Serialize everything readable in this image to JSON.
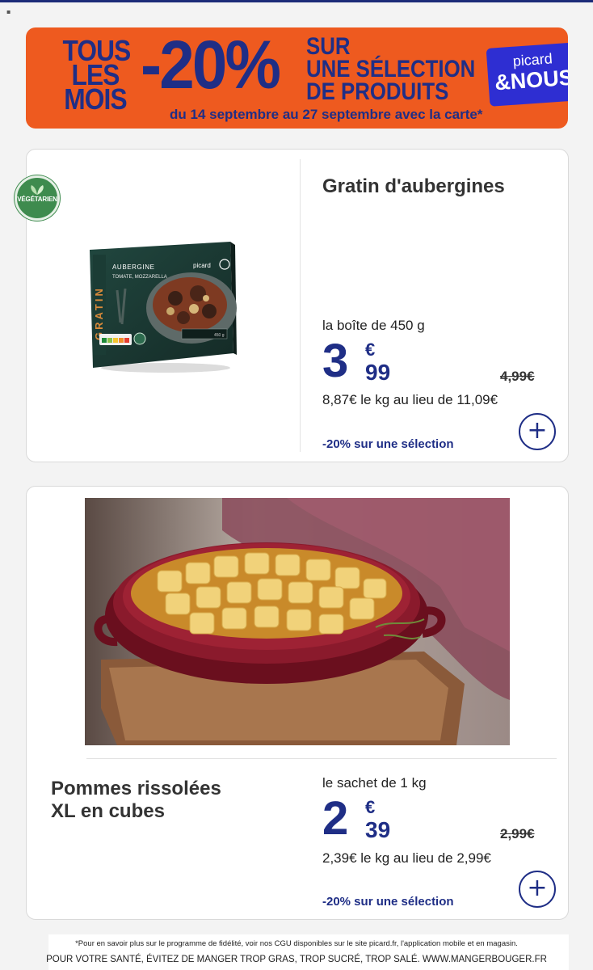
{
  "banner": {
    "line_left": [
      "TOUS",
      "LES",
      "MOIS"
    ],
    "discount": "-20%",
    "line_right": [
      "SUR",
      "UNE SÉLECTION",
      "DE PRODUITS"
    ],
    "dates": "du 14 septembre au 27 septembre avec la carte*",
    "logo_top": "picard",
    "logo_bottom": "&NOUS",
    "bg_color": "#ee5a1f",
    "text_color": "#1f2e86"
  },
  "products": [
    {
      "badge": "VÉGÉTARIEN",
      "title": "Gratin d'aubergines",
      "quantity": "la boîte de 450 g",
      "price_int": "3",
      "price_currency": "€",
      "price_dec": "99",
      "old_price": "4,99€",
      "per_kg": "8,87€ le kg au lieu de 11,09€",
      "promo": "-20% sur une sélection",
      "image": {
        "box_title": "AUBERGINE",
        "box_subtitle": "TOMATE, MOZZARELLA",
        "box_side": "GRATIN",
        "box_brand": "picard",
        "box_weight": "450 g"
      }
    },
    {
      "title_lines": [
        "Pommes rissolées",
        "XL en cubes"
      ],
      "quantity": "le sachet de 1 kg",
      "price_int": "2",
      "price_currency": "€",
      "price_dec": "39",
      "old_price": "2,99€",
      "per_kg": "2,39€ le kg au lieu de 2,99€",
      "promo": "-20% sur une sélection"
    }
  ],
  "footer": {
    "footnote": "*Pour en savoir plus sur le programme de fidélité, voir nos CGU disponibles sur le site picard.fr, l'application mobile et en magasin.",
    "health": "POUR VOTRE SANTÉ, ÉVITEZ DE MANGER TROP GRAS, TROP SUCRÉ, TROP SALÉ. WWW.MANGERBOUGER.FR"
  },
  "icons": {
    "add": "plus-circle-icon",
    "leaf": "leaf-icon"
  }
}
